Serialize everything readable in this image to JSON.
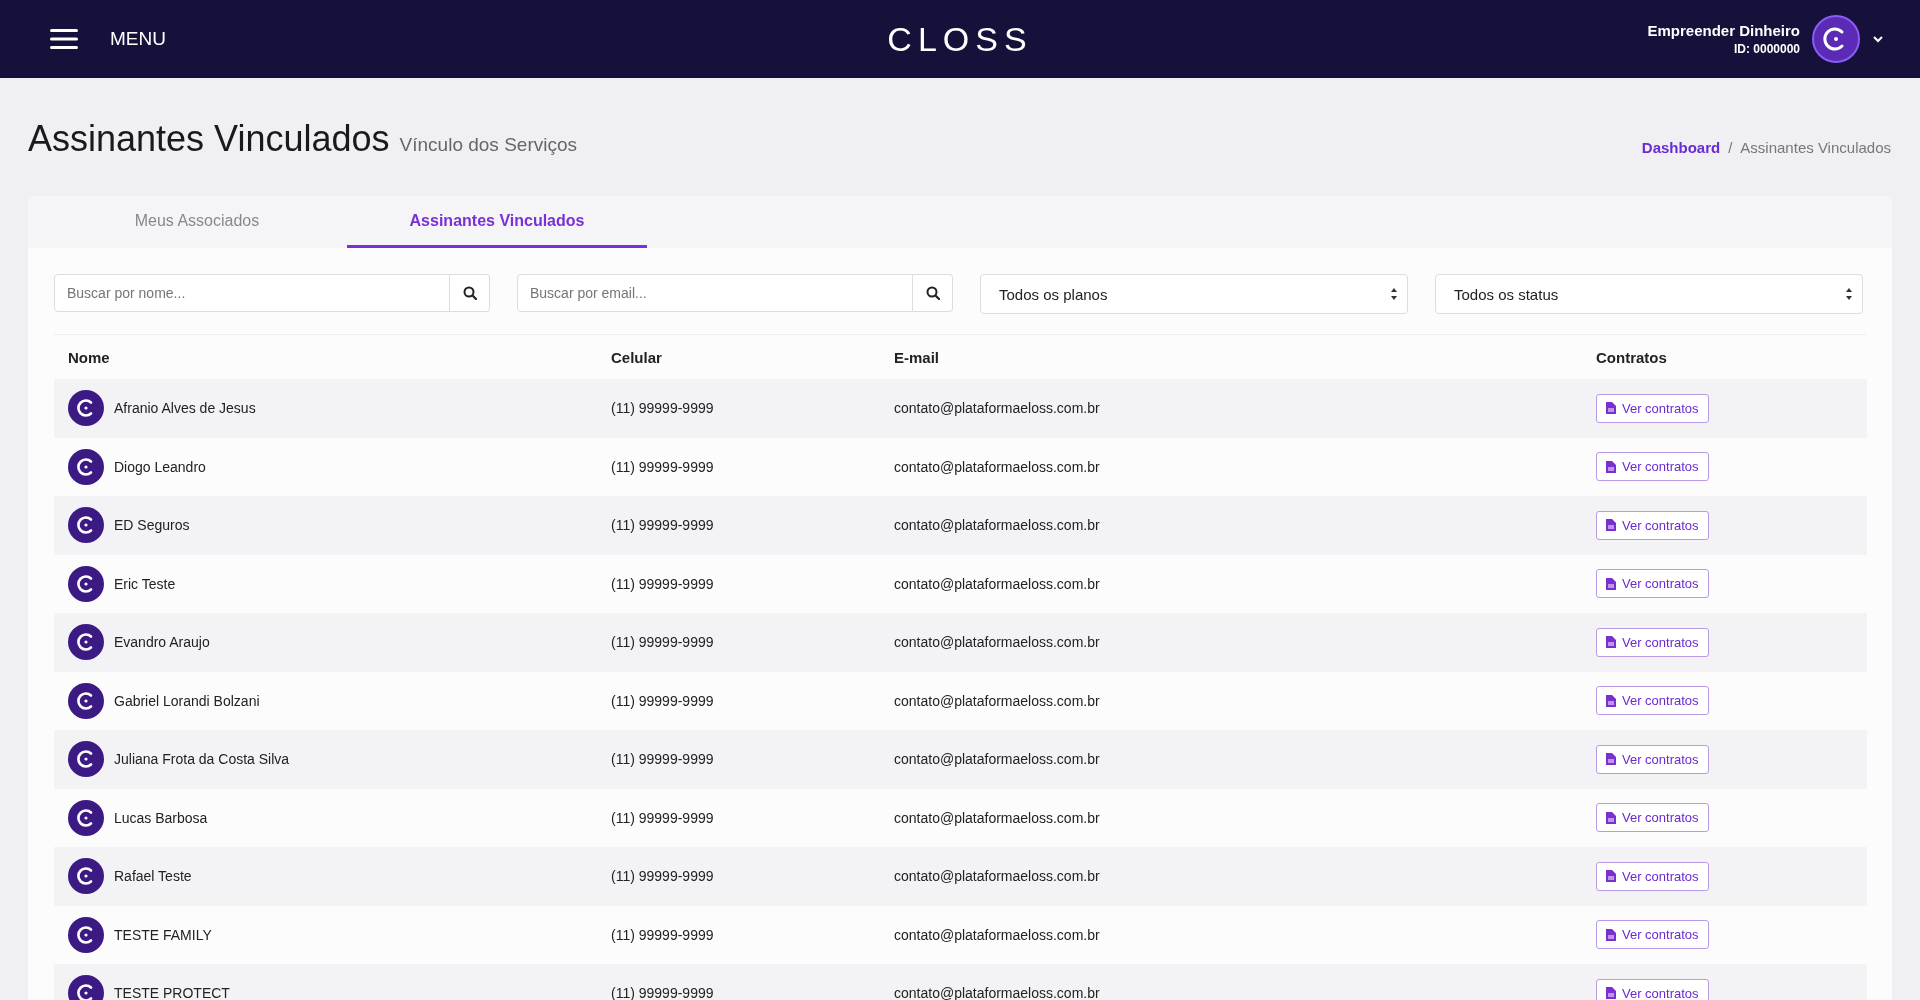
{
  "header": {
    "menu_label": "MENU",
    "logo": "CLOSS",
    "user_name": "Empreender Dinheiro",
    "user_id": "ID: 0000000"
  },
  "page": {
    "title": "Assinantes Vinculados",
    "subtitle": "Vínculo dos Serviços"
  },
  "breadcrumb": [
    {
      "label": "Dashboard",
      "kind": "link"
    },
    {
      "label": "/",
      "kind": "separator"
    },
    {
      "label": "Assinantes Vinculados",
      "kind": "current"
    }
  ],
  "tabs": [
    {
      "label": "Meus Associados",
      "selected": false
    },
    {
      "label": "Assinantes Vinculados",
      "selected": true
    }
  ],
  "filters": [
    {
      "kind": "search",
      "placeholder": "Buscar por nome..."
    },
    {
      "kind": "search",
      "placeholder": "Buscar por email..."
    },
    {
      "kind": "select",
      "value": "Todos os planos"
    },
    {
      "kind": "select",
      "value": "Todos os status"
    }
  ],
  "table": {
    "columns": [
      "Nome",
      "Celular",
      "E-mail",
      "Contratos"
    ],
    "rows": [
      {
        "name": "Afranio Alves de Jesus",
        "phone": "(11) 99999-9999",
        "email": "contato@plataformaeloss.com.br",
        "action": "Ver contratos"
      },
      {
        "name": "Diogo Leandro",
        "phone": "(11) 99999-9999",
        "email": "contato@plataformaeloss.com.br",
        "action": "Ver contratos"
      },
      {
        "name": "ED Seguros",
        "phone": "(11) 99999-9999",
        "email": "contato@plataformaeloss.com.br",
        "action": "Ver contratos"
      },
      {
        "name": "Eric Teste",
        "phone": "(11) 99999-9999",
        "email": "contato@plataformaeloss.com.br",
        "action": "Ver contratos"
      },
      {
        "name": "Evandro Araujo",
        "phone": "(11) 99999-9999",
        "email": "contato@plataformaeloss.com.br",
        "action": "Ver contratos"
      },
      {
        "name": "Gabriel Lorandi Bolzani",
        "phone": "(11) 99999-9999",
        "email": "contato@plataformaeloss.com.br",
        "action": "Ver contratos"
      },
      {
        "name": "Juliana Frota da Costa Silva",
        "phone": "(11) 99999-9999",
        "email": "contato@plataformaeloss.com.br",
        "action": "Ver contratos"
      },
      {
        "name": "Lucas Barbosa",
        "phone": "(11) 99999-9999",
        "email": "contato@plataformaeloss.com.br",
        "action": "Ver contratos"
      },
      {
        "name": "Rafael Teste",
        "phone": "(11) 99999-9999",
        "email": "contato@plataformaeloss.com.br",
        "action": "Ver contratos"
      },
      {
        "name": "TESTE FAMILY",
        "phone": "(11) 99999-9999",
        "email": "contato@plataformaeloss.com.br",
        "action": "Ver contratos"
      },
      {
        "name": "TESTE PROTECT",
        "phone": "(11) 99999-9999",
        "email": "contato@plataformaeloss.com.br",
        "action": "Ver contratos"
      }
    ]
  }
}
